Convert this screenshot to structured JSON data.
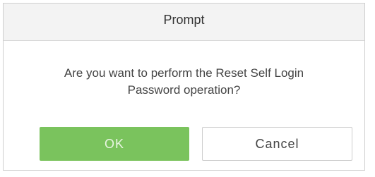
{
  "dialog": {
    "title": "Prompt",
    "message_line1": "Are you want to perform the Reset Self Login",
    "message_line2": "Password operation?",
    "ok_label": "OK",
    "cancel_label": "Cancel"
  },
  "colors": {
    "ok_button": "#7ac35d",
    "titlebar": "#f3f3f3"
  }
}
